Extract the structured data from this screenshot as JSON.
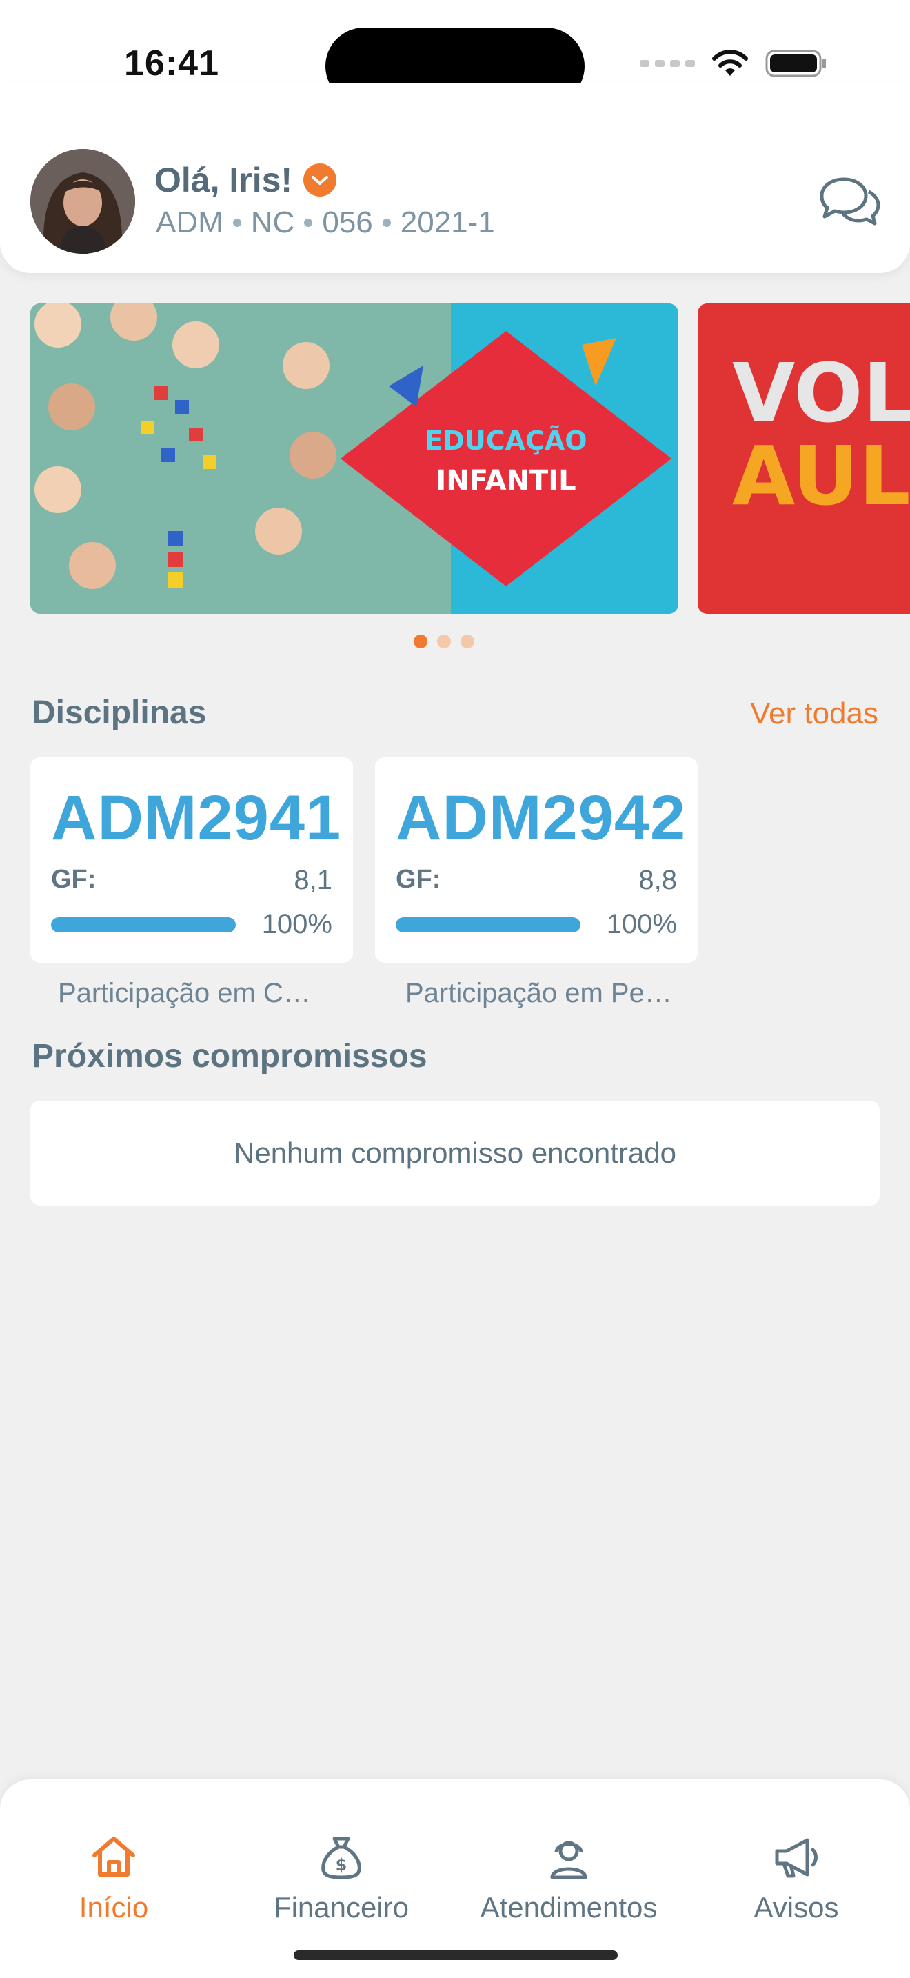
{
  "status_bar": {
    "time": "16:41"
  },
  "header": {
    "greeting": "Olá, Iris!",
    "info": [
      "ADM",
      "NC",
      "056",
      "2021-1"
    ],
    "icons": {
      "verified": "check-badge-icon",
      "chat": "chat-bubbles-icon"
    }
  },
  "banners": [
    {
      "title_line1": "EDUCAÇÃO",
      "title_line2": "INFANTIL"
    },
    {
      "title_line1": "VOL",
      "title_line2": "AUL"
    }
  ],
  "carousel": {
    "total": 3,
    "active_index": 0
  },
  "disciplinas": {
    "title": "Disciplinas",
    "see_all": "Ver todas",
    "items": [
      {
        "code": "ADM2941",
        "gf_label": "GF:",
        "gf_value": "8,1",
        "progress": 100,
        "progress_label": "100%",
        "name": "Participação em Campanhas Acadêmicas"
      },
      {
        "code": "ADM2942",
        "gf_label": "GF:",
        "gf_value": "8,8",
        "progress": 100,
        "progress_label": "100%",
        "name": "Participação em Pesquisas Institucionais"
      }
    ]
  },
  "compromissos": {
    "title": "Próximos compromissos",
    "empty": "Nenhum compromisso encontrado"
  },
  "nav": {
    "items": [
      {
        "label": "Início",
        "icon": "home-icon",
        "active": true
      },
      {
        "label": "Financeiro",
        "icon": "money-bag-icon",
        "active": false
      },
      {
        "label": "Atendimentos",
        "icon": "support-agent-icon",
        "active": false
      },
      {
        "label": "Avisos",
        "icon": "megaphone-icon",
        "active": false
      }
    ]
  },
  "colors": {
    "accent": "#f07b2f",
    "primary": "#3fa6dc",
    "text": "#5c7382",
    "background": "#f0f0f0"
  }
}
